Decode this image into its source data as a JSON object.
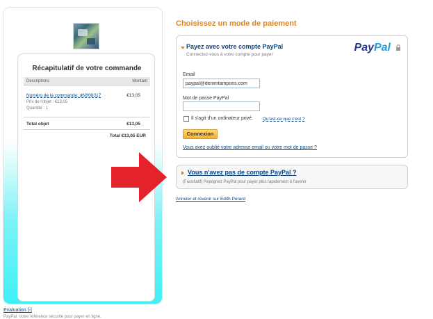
{
  "summary": {
    "title": "Récapitulatif de votre commande",
    "col_description": "Descriptions",
    "col_amount": "Montant",
    "item_link": "Numéro de la commande: d60f08317",
    "item_amount": "€13,05",
    "item_price": "Prix de l'objet : €13,05",
    "item_qty": "Quantité : 1",
    "total_label": "Total objet",
    "total_amount": "€13,05",
    "grand_total": "Total €13,05 EUR"
  },
  "footer": {
    "evaluation": "Évaluation [-]",
    "note": "PayPal. Votre référence sécurité pour payer en ligne."
  },
  "payment": {
    "heading": "Choisissez un mode de paiement",
    "login": {
      "title": "Payez avec votre compte PayPal",
      "subtitle": "Connectez-vous à votre compte pour payer",
      "paypal_pay": "Pay",
      "paypal_pal": "Pal",
      "email_label": "Email",
      "email_value": "paypal@denimtampons.com",
      "password_label": "Mot de passe PayPal",
      "private_label": "Il s'agit d'un ordinateur privé.",
      "whatis_link": "Qu'est-ce que c'est ?",
      "connect_button": "Connexion",
      "forgot_link": "Vous avez oublié votre adresse email ou votre mot de passe ?"
    },
    "no_account": {
      "title": "Vous n'avez pas de compte PayPal ?",
      "subtitle": "(Facultatif) Rejoignez PayPal pour payer plus rapidement à l'avenir"
    },
    "cancel_link": "Annuler et revenir sur Edith Perard"
  },
  "colors": {
    "accent_orange": "#e0851b",
    "link_blue": "#084482",
    "arrow_red": "#e4222a",
    "panel_cyan": "#3ff0f7"
  }
}
